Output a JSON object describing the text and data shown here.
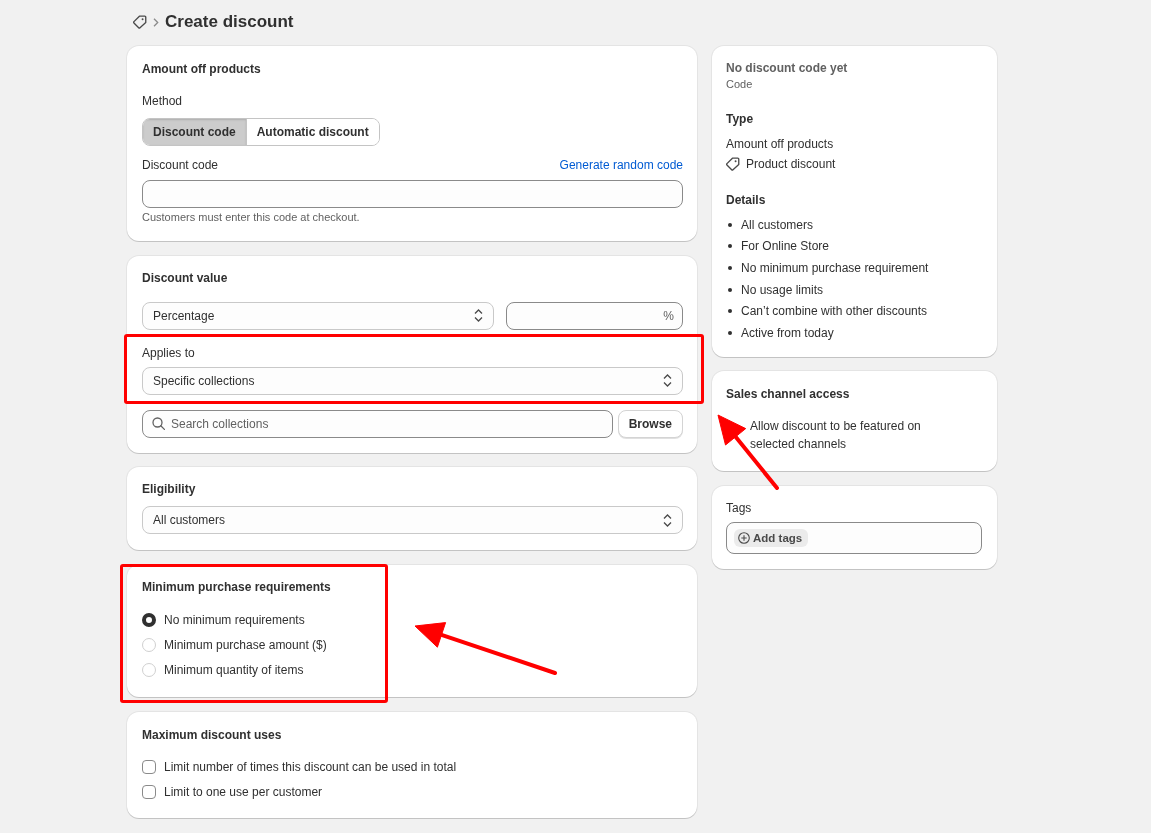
{
  "header": {
    "title": "Create discount"
  },
  "method_card": {
    "title": "Amount off products",
    "method_label": "Method",
    "methods": [
      {
        "label": "Discount code",
        "selected": true
      },
      {
        "label": "Automatic discount",
        "selected": false
      }
    ],
    "code_label": "Discount code",
    "generate_link": "Generate random code",
    "code_help": "Customers must enter this code at checkout."
  },
  "value_card": {
    "title": "Discount value",
    "type_select": "Percentage",
    "value_suffix": "%",
    "applies_to": {
      "label": "Applies to",
      "value": "Specific collections",
      "highlighted": true
    },
    "search": {
      "placeholder": "Search collections"
    },
    "browse_button": "Browse"
  },
  "eligibility": {
    "title": "Eligibility",
    "value": "All customers"
  },
  "minimum_purchase": {
    "title": "Minimum purchase requirements",
    "highlighted": true,
    "arrow": true,
    "options": [
      {
        "label": "No minimum requirements",
        "selected": true
      },
      {
        "label": "Minimum purchase amount ($)",
        "selected": false
      },
      {
        "label": "Minimum quantity of items",
        "selected": false
      }
    ]
  },
  "maximum_uses": {
    "title": "Maximum discount uses",
    "options": [
      {
        "label": "Limit number of times this discount can be used in total",
        "checked": false
      },
      {
        "label": "Limit to one use per customer",
        "checked": false
      }
    ]
  },
  "summary": {
    "code_status": "No discount code yet",
    "code_caption": "Code",
    "type_heading": "Type",
    "type_value": "Amount off products",
    "type_kind": "Product discount",
    "details_heading": "Details",
    "details": [
      "All customers",
      "For Online Store",
      "No minimum purchase requirement",
      "No usage limits",
      "Can’t combine with other discounts",
      "Active from today"
    ]
  },
  "sales_channel": {
    "title": "Sales channel access",
    "text": "Allow discount to be featured on selected channels",
    "arrow": true
  },
  "tags": {
    "label": "Tags",
    "add_button": "Add tags"
  }
}
